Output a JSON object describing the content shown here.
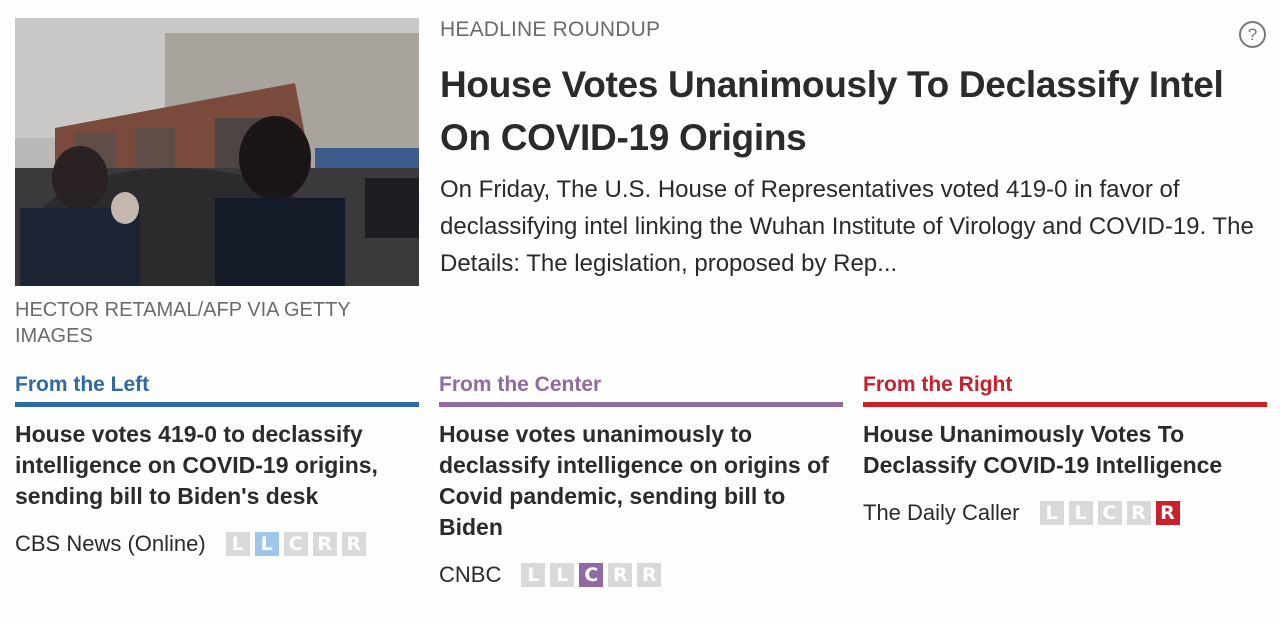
{
  "kicker": "HEADLINE ROUNDUP",
  "help_icon": "?",
  "headline": "House Votes Unanimously To Declassify Intel On COVID-19 Origins",
  "summary": "On Friday, The U.S. House of Representatives voted 419-0 in favor of declassifying intel linking the Wuhan Institute of Virology and COVID-19. The Details: The legislation, proposed by Rep...",
  "photo": {
    "alt": "People and a car outside the Wuhan Institute of Virology entrance",
    "credit": "HECTOR RETAMAL/AFP VIA GETTY IMAGES"
  },
  "colors": {
    "left": "#2e6aa8",
    "center": "#8f6aa3",
    "right": "#cc1f2a",
    "bias_inactive": "#d9d9d9",
    "bias_left_active": "#9ec6ea"
  },
  "columns": [
    {
      "side": "left",
      "label": "From the Left",
      "title": "House votes 419-0 to declassify intelligence on COVID-19 origins, sending bill to Biden's desk",
      "source": "CBS News (Online)",
      "bias_letters": [
        "L",
        "L",
        "C",
        "R",
        "R"
      ],
      "bias_active_index": 1
    },
    {
      "side": "center",
      "label": "From the Center",
      "title": "House votes unanimously to declassify intelligence on origins of Covid pandemic, sending bill to Biden",
      "source": "CNBC",
      "bias_letters": [
        "L",
        "L",
        "C",
        "R",
        "R"
      ],
      "bias_active_index": 2
    },
    {
      "side": "right",
      "label": "From the Right",
      "title": "House Unanimously Votes To Declassify COVID-19 Intelligence",
      "source": "The Daily Caller",
      "bias_letters": [
        "L",
        "L",
        "C",
        "R",
        "R"
      ],
      "bias_active_index": 4
    }
  ]
}
